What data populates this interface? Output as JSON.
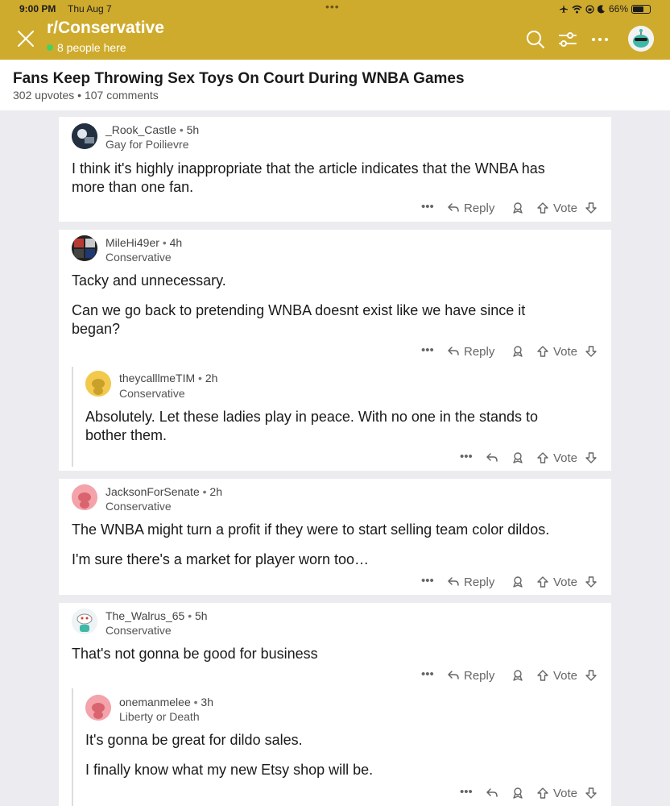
{
  "status_bar": {
    "time": "9:00 PM",
    "date": "Thu Aug 7",
    "battery": "66%",
    "menu_dots": "•••"
  },
  "header": {
    "subreddit": "r/Conservative",
    "online": "8 people here"
  },
  "post": {
    "title": "Fans Keep Throwing Sex Toys On Court During WNBA Games",
    "meta": "302 upvotes • 107 comments"
  },
  "labels": {
    "reply": "Reply",
    "vote": "Vote",
    "more": "•••",
    "dot": "•"
  },
  "comments": [
    {
      "user": "_Rook_Castle",
      "age": "5h",
      "flair": "Gay for Poilievre",
      "body": [
        "I think it's highly inappropriate that the article indicates that the WNBA has",
        "more than one fan."
      ]
    },
    {
      "user": "MileHi49er",
      "age": "4h",
      "flair": "Conservative",
      "body": [
        "Tacky and unnecessary.",
        "Can we go back to pretending WNBA doesnt exist like we have since it",
        "began?"
      ]
    },
    {
      "user": "theycalllmeTIM",
      "age": "2h",
      "flair": "Conservative",
      "body": [
        "Absolutely.  Let these ladies play in peace.  With no one in the stands to",
        "bother them."
      ]
    },
    {
      "user": "JacksonForSenate",
      "age": "2h",
      "flair": "Conservative",
      "body": [
        "The WNBA might turn a profit if they were to start selling team color dildos.",
        "I'm sure there's a market for player worn too…"
      ]
    },
    {
      "user": "The_Walrus_65",
      "age": "5h",
      "flair": "Conservative",
      "body": [
        "That's not gonna be good for business"
      ]
    },
    {
      "user": "onemanmelee",
      "age": "3h",
      "flair": "Liberty or Death",
      "body": [
        "It's gonna be great for dildo sales.",
        "I finally know what my new Etsy shop will be."
      ]
    }
  ],
  "colors": {
    "header_bg": "#cfab2d",
    "online_dot": "#46d160",
    "page_bg": "#ececf0"
  }
}
